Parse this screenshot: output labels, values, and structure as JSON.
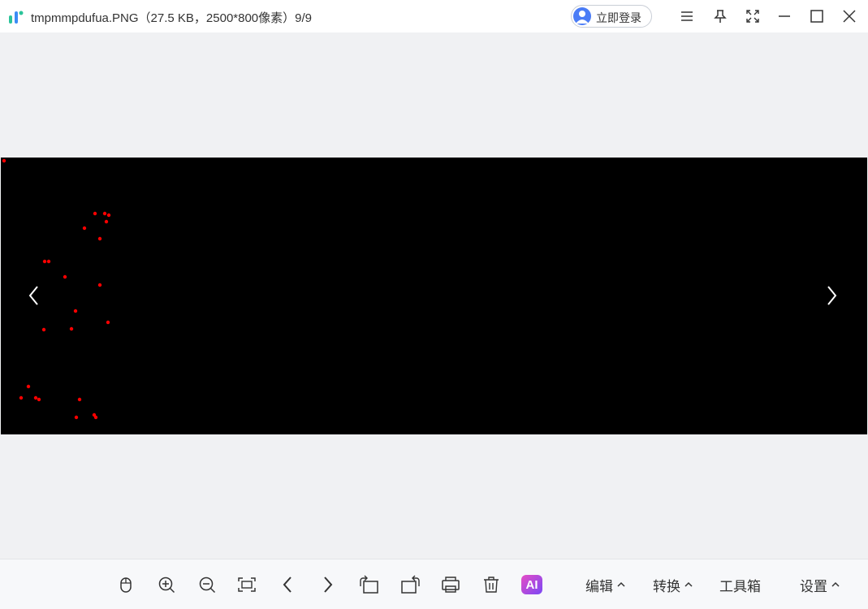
{
  "window": {
    "title": "tmpmmpdufua.PNG（27.5 KB，2500*800像素）9/9",
    "login_label": "立即登录",
    "icons": [
      "app-logo",
      "user-avatar-icon",
      "menu-icon",
      "pin-icon",
      "fullscreen-icon",
      "minimize-icon",
      "maximize-icon",
      "close-icon"
    ]
  },
  "viewer": {
    "background": "#000000",
    "point_color": "#ff0000",
    "icons": [
      "chevron-left-icon",
      "chevron-right-icon"
    ]
  },
  "toolbar": {
    "tools": [
      "mouse-icon",
      "zoom-in-icon",
      "zoom-out-icon",
      "fit-screen-icon",
      "previous-icon",
      "next-icon",
      "rotate-left-icon",
      "rotate-right-icon",
      "print-icon",
      "delete-icon"
    ],
    "ai_label": "AI",
    "edit_label": "编辑",
    "convert_label": "转换",
    "toolbox_label": "工具箱",
    "settings_label": "设置"
  }
}
